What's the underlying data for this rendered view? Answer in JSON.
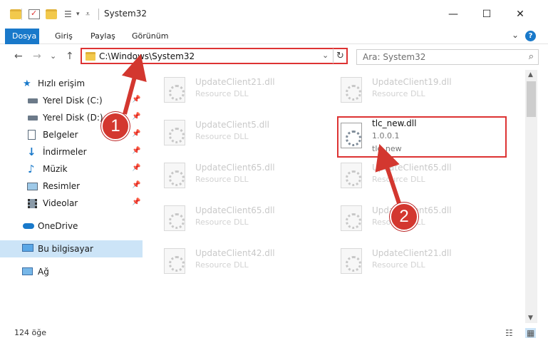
{
  "window": {
    "title": "System32",
    "controls": {
      "minimize": "—",
      "maximize": "☐",
      "close": "✕"
    }
  },
  "ribbon": {
    "tabs": [
      "Dosya",
      "Giriş",
      "Paylaş",
      "Görünüm"
    ],
    "help": "?",
    "expand": "⌄"
  },
  "address": {
    "back": "←",
    "forward": "→",
    "recent": "⌄",
    "up": "↑",
    "path": "C:\\Windows\\System32",
    "dropdown": "⌄",
    "refresh": "↻",
    "search_placeholder": "Ara: System32",
    "search_icon": "⌕"
  },
  "sidebar": {
    "items": [
      {
        "label": "Hızlı erişim",
        "icon": "star-icon"
      },
      {
        "label": "Yerel Disk (C:)",
        "icon": "drive-icon",
        "pinned": true
      },
      {
        "label": "Yerel Disk (D:)",
        "icon": "drive-icon",
        "pinned": true
      },
      {
        "label": "Belgeler",
        "icon": "documents-icon",
        "pinned": true
      },
      {
        "label": "İndirmeler",
        "icon": "download-icon",
        "pinned": true
      },
      {
        "label": "Müzik",
        "icon": "music-icon",
        "pinned": true
      },
      {
        "label": "Resimler",
        "icon": "pictures-icon",
        "pinned": true
      },
      {
        "label": "Videolar",
        "icon": "videos-icon",
        "pinned": true
      },
      {
        "label": "OneDrive",
        "icon": "cloud-icon"
      },
      {
        "label": "Bu bilgisayar",
        "icon": "computer-icon",
        "selected": true
      },
      {
        "label": "Ağ",
        "icon": "network-icon"
      }
    ],
    "pin_glyph": "📌"
  },
  "files": [
    {
      "name": "UpdateClient21.dll",
      "type": "Resource DLL"
    },
    {
      "name": "UpdateClient19.dll",
      "type": "Resource DLL"
    },
    {
      "name": "UpdateClient5.dll",
      "type": "Resource DLL"
    },
    {
      "name": "tlc_new.dll",
      "version": "1.0.0.1",
      "type": "tlc_new",
      "focused": true
    },
    {
      "name": "UpdateClient65.dll",
      "type": "Resource DLL"
    },
    {
      "name": "UpdateClient65.dll",
      "type": "Resource DLL"
    },
    {
      "name": "UpdateClient65.dll",
      "type": "Resource DLL"
    },
    {
      "name": "UpdateClient65.dll",
      "type": "Resource DLL"
    },
    {
      "name": "UpdateClient42.dll",
      "type": "Resource DLL"
    },
    {
      "name": "UpdateClient21.dll",
      "type": "Resource DLL"
    }
  ],
  "status": {
    "count": "124 öğe",
    "details_view": "☷",
    "tiles_view": "▦"
  },
  "annotations": {
    "step1": "1",
    "step2": "2",
    "color": "#d3372f"
  }
}
